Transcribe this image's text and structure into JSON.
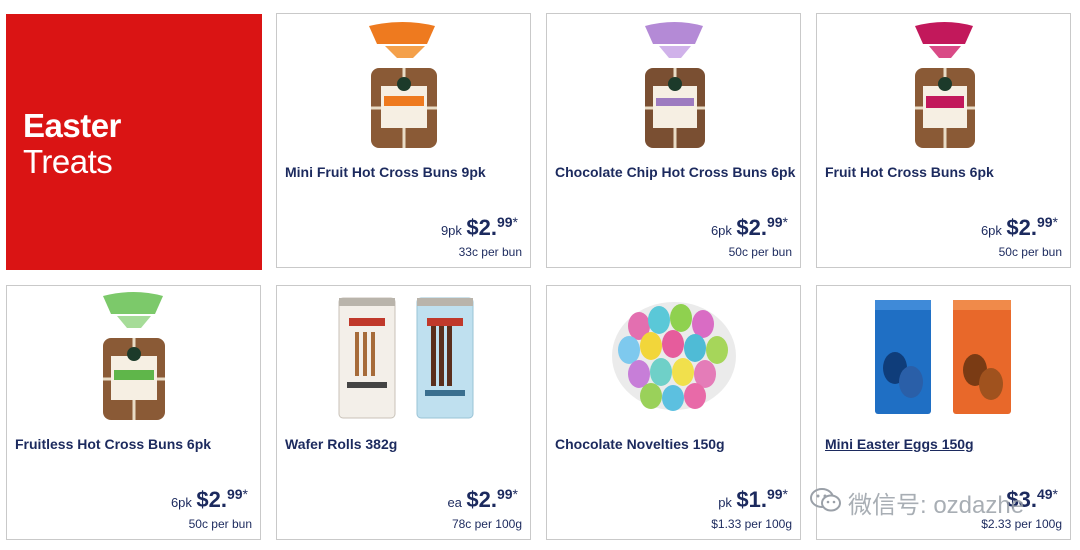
{
  "banner": {
    "line1": "Easter",
    "line2": "Treats",
    "color": "#da1414"
  },
  "products": [
    {
      "name": "Mini Fruit Hot Cross Buns 9pk",
      "unit": "9pk",
      "dollars": "$2.",
      "cents": "99",
      "star": "*",
      "per_unit": "33c per bun",
      "image": "hot-cross-buns-bag-orange"
    },
    {
      "name": "Chocolate Chip Hot Cross Buns 6pk",
      "unit": "6pk",
      "dollars": "$2.",
      "cents": "99",
      "star": "*",
      "per_unit": "50c per bun",
      "image": "hot-cross-buns-bag-purple"
    },
    {
      "name": "Fruit Hot Cross Buns 6pk",
      "unit": "6pk",
      "dollars": "$2.",
      "cents": "99",
      "star": "*",
      "per_unit": "50c per bun",
      "image": "hot-cross-buns-bag-magenta"
    },
    {
      "name": "Fruitless Hot Cross Buns 6pk",
      "unit": "6pk",
      "dollars": "$2.",
      "cents": "99",
      "star": "*",
      "per_unit": "50c per bun",
      "image": "hot-cross-buns-bag-green"
    },
    {
      "name": "Wafer Rolls 382g",
      "unit": "ea",
      "dollars": "$2.",
      "cents": "99",
      "star": "*",
      "per_unit": "78c per 100g",
      "image": "wafer-roll-tubs"
    },
    {
      "name": "Chocolate Novelties 150g",
      "unit": "pk",
      "dollars": "$1.",
      "cents": "99",
      "star": "*",
      "per_unit": "$1.33 per 100g",
      "image": "foil-eggs-bag"
    },
    {
      "name": "Mini Easter Eggs 150g",
      "unit": "",
      "dollars": "$3.",
      "cents": "49",
      "star": "*",
      "per_unit": "$2.33 per 100g",
      "image": "mini-egg-bags"
    }
  ],
  "watermark": {
    "text": "微信号: ozdazhe",
    "icon": "wechat-icon"
  }
}
